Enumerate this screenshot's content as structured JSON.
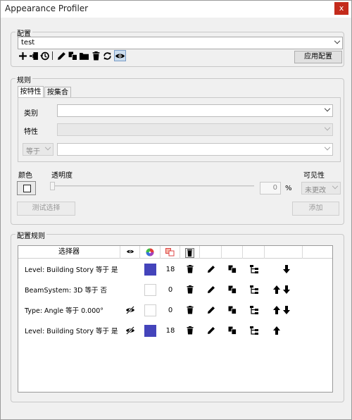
{
  "window": {
    "title": "Appearance Profiler",
    "close": "x"
  },
  "config": {
    "legend": "配置",
    "selected": "test",
    "apply_label": "应用配置",
    "toolbar_icons": [
      "add-icon",
      "import-icon",
      "history-icon",
      "edit-icon",
      "copy-icon",
      "folder-icon",
      "delete-icon",
      "refresh-icon",
      "eye-icon"
    ]
  },
  "rules": {
    "legend": "规则",
    "tabs": [
      "按特性",
      "按集合"
    ],
    "category_label": "类别",
    "category_value": "",
    "property_label": "特性",
    "property_value": "",
    "operator_value": "等于",
    "value_value": "",
    "color_label": "颜色",
    "transparency_label": "透明度",
    "transparency_value": "0",
    "transparency_unit": "%",
    "visibility_label": "可见性",
    "visibility_value": "未更改",
    "test_label": "测试选择",
    "add_label": "添加"
  },
  "config_rules": {
    "legend": "配置规则",
    "header_selector": "选择器",
    "rows": [
      {
        "selector": "Level: Building Story 等于 是",
        "hidden": false,
        "color": "#4444bb",
        "count": "18",
        "up": false,
        "down": true
      },
      {
        "selector": "BeamSystem: 3D 等于 否",
        "hidden": false,
        "color": "#ffffff",
        "count": "0",
        "up": true,
        "down": true
      },
      {
        "selector": "Type: Angle 等于 0.000°",
        "hidden": true,
        "color": "#ffffff",
        "count": "0",
        "up": true,
        "down": true
      },
      {
        "selector": "Level: Building Story 等于 是",
        "hidden": true,
        "color": "#4444bb",
        "count": "18",
        "up": true,
        "down": false
      }
    ]
  }
}
